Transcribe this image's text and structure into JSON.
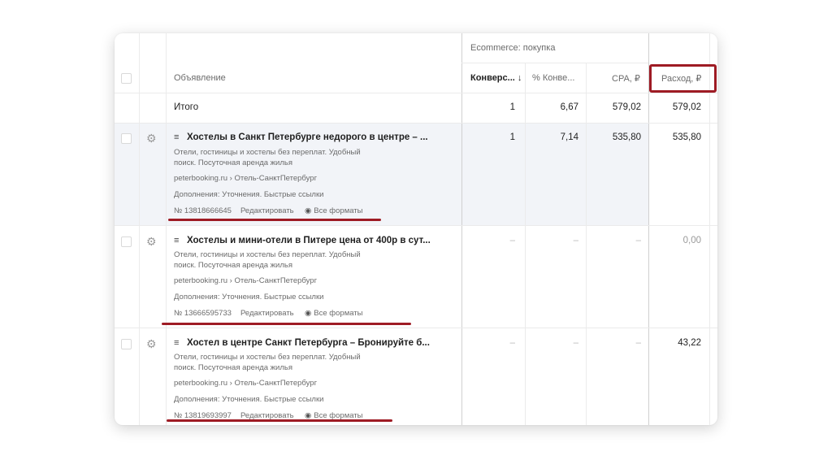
{
  "header": {
    "group_label": "Ecommerce: покупка",
    "col_ad": "Объявление",
    "col_conv": "Конверс... ↓",
    "col_conv_pct": "% Конве...",
    "col_cpa": "CPA, ₽",
    "col_spend": "Расход, ₽"
  },
  "total": {
    "label": "Итого",
    "conv": "1",
    "conv_pct": "6,67",
    "cpa": "579,02",
    "spend": "579,02"
  },
  "rows": [
    {
      "title": "Хостелы в Санкт Петербурге недорого в центре – ...",
      "desc1": "Отели, гостиницы и хостелы без переплат. Удобный",
      "desc2": "поиск. Посуточная аренда жилья",
      "url": "peterbooking.ru › Отель-СанктПетербург",
      "extras": "Дополнения: Уточнения. Быстрые ссылки",
      "id": "№ 13818666645",
      "edit": "Редактировать",
      "formats": "Все форматы",
      "conv": "1",
      "conv_pct": "7,14",
      "cpa": "535,80",
      "spend": "535,80"
    },
    {
      "title": "Хостелы и мини-отели в Питере цена от 400р в сут...",
      "desc1": "Отели, гостиницы и хостелы без переплат. Удобный",
      "desc2": "поиск. Посуточная аренда жилья",
      "url": "peterbooking.ru › Отель-СанктПетербург",
      "extras": "Дополнения: Уточнения. Быстрые ссылки",
      "id": "№ 13666595733",
      "edit": "Редактировать",
      "formats": "Все форматы",
      "conv": "–",
      "conv_pct": "–",
      "cpa": "–",
      "spend": "0,00"
    },
    {
      "title": "Хостел в центре Санкт Петербурга – Бронируйте б...",
      "desc1": "Отели, гостиницы и хостелы без переплат. Удобный",
      "desc2": "поиск. Посуточная аренда жилья",
      "url": "peterbooking.ru › Отель-СанктПетербург",
      "extras": "Дополнения: Уточнения. Быстрые ссылки",
      "id": "№ 13819693997",
      "edit": "Редактировать",
      "formats": "Все форматы",
      "conv": "–",
      "conv_pct": "–",
      "cpa": "–",
      "spend": "43,22"
    }
  ],
  "colors": {
    "highlight": "#9e1b24",
    "selected_row_bg": "#f2f4f8"
  },
  "icons": [
    "gear-icon",
    "ad-text-icon",
    "eye-icon",
    "checkbox"
  ]
}
